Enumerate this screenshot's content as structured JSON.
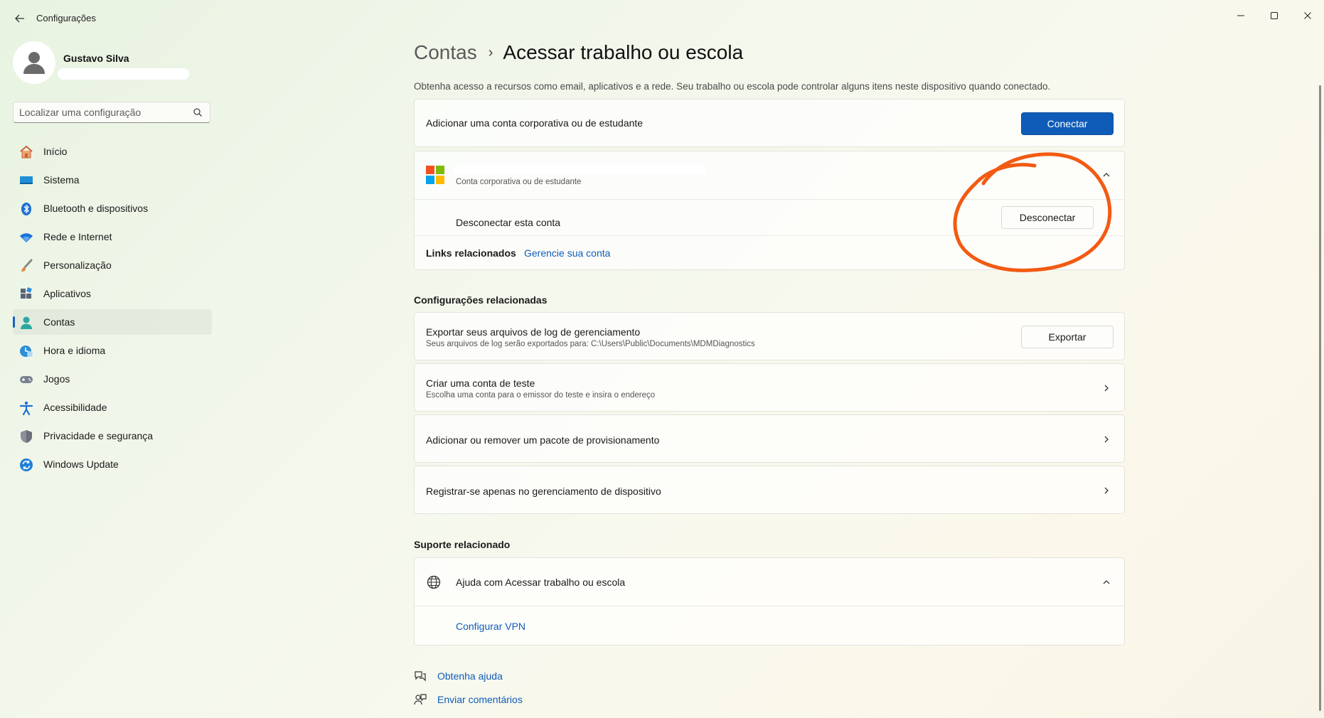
{
  "window": {
    "title": "Configurações",
    "back_icon": "arrow-left-icon",
    "controls": [
      "minimize-icon",
      "maximize-icon",
      "close-icon"
    ]
  },
  "profile": {
    "name": "Gustavo Silva"
  },
  "search": {
    "placeholder": "Localizar uma configuração"
  },
  "sidebar": {
    "items": [
      {
        "label": "Início",
        "icon": "home-icon"
      },
      {
        "label": "Sistema",
        "icon": "monitor-icon"
      },
      {
        "label": "Bluetooth e dispositivos",
        "icon": "bluetooth-icon"
      },
      {
        "label": "Rede e Internet",
        "icon": "wifi-icon"
      },
      {
        "label": "Personalização",
        "icon": "brush-icon"
      },
      {
        "label": "Aplicativos",
        "icon": "apps-icon"
      },
      {
        "label": "Contas",
        "icon": "person-icon",
        "selected": true
      },
      {
        "label": "Hora e idioma",
        "icon": "clock-globe-icon"
      },
      {
        "label": "Jogos",
        "icon": "gamepad-icon"
      },
      {
        "label": "Acessibilidade",
        "icon": "accessibility-icon"
      },
      {
        "label": "Privacidade e segurança",
        "icon": "shield-icon"
      },
      {
        "label": "Windows Update",
        "icon": "update-icon"
      }
    ]
  },
  "header": {
    "parent": "Contas",
    "separator": "›",
    "current": "Acessar trabalho ou escola"
  },
  "intro": "Obtenha acesso a recursos como email, aplicativos e a rede. Seu trabalho ou escola pode controlar alguns itens neste dispositivo quando conectado.",
  "add_account": {
    "label": "Adicionar uma conta corporativa ou de estudante",
    "button": "Conectar"
  },
  "account": {
    "subtitle": "Conta corporativa ou de estudante",
    "disconnect_label": "Desconectar esta conta",
    "disconnect_button": "Desconectar",
    "related_links_label": "Links relacionados",
    "manage_link": "Gerencie sua conta"
  },
  "related_settings": {
    "header": "Configurações relacionadas",
    "items": [
      {
        "title": "Exportar seus arquivos de log de gerenciamento",
        "subtitle": "Seus arquivos de log serão exportados para: C:\\Users\\Public\\Documents\\MDMDiagnostics",
        "button": "Exportar"
      },
      {
        "title": "Criar uma conta de teste",
        "subtitle": "Escolha uma conta para o emissor do teste e insira o endereço"
      },
      {
        "title": "Adicionar ou remover um pacote de provisionamento"
      },
      {
        "title": "Registrar-se apenas no gerenciamento de dispositivo"
      }
    ]
  },
  "related_support": {
    "header": "Suporte relacionado",
    "help_title": "Ajuda com Acessar trabalho ou escola",
    "vpn_link": "Configurar VPN"
  },
  "footer_links": {
    "help": "Obtenha ajuda",
    "feedback": "Enviar comentários"
  },
  "colors": {
    "accent": "#0f5cb8",
    "annotation": "#f25a12"
  }
}
